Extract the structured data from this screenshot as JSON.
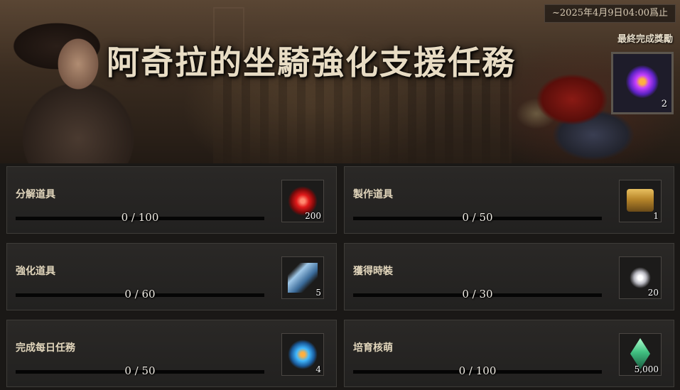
{
  "header": {
    "title": "阿奇拉的坐騎強化支援任務",
    "deadline": "~2025年4月9日04:00爲止",
    "final_reward_label": "最終完成獎勵",
    "final_reward": {
      "icon": "purple-energy-orb-icon",
      "count": "2"
    }
  },
  "missions": [
    {
      "label": "分解道具",
      "progress_text": "0 / 100",
      "current": 0,
      "target": 100,
      "reward_icon": "red-orb-icon",
      "reward_count": "200"
    },
    {
      "label": "製作道具",
      "progress_text": "0 / 50",
      "current": 0,
      "target": 50,
      "reward_icon": "gold-chest-icon",
      "reward_count": "1"
    },
    {
      "label": "強化道具",
      "progress_text": "0 / 60",
      "current": 0,
      "target": 60,
      "reward_icon": "blue-crystal-icon",
      "reward_count": "5"
    },
    {
      "label": "獲得時裝",
      "progress_text": "0 / 30",
      "current": 0,
      "target": 30,
      "reward_icon": "silver-token-icon",
      "reward_count": "20"
    },
    {
      "label": "完成每日任務",
      "progress_text": "0 / 50",
      "current": 0,
      "target": 50,
      "reward_icon": "cyan-energy-orb-icon",
      "reward_count": "4"
    },
    {
      "label": "培育核萌",
      "progress_text": "0 / 100",
      "current": 0,
      "target": 100,
      "reward_icon": "green-gem-icon",
      "reward_count": "5,000"
    }
  ]
}
